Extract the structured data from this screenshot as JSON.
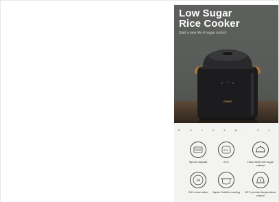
{
  "product": {
    "title_line1": "Low Sugar",
    "title_line2": "Rice Cooker",
    "subtitle": "Start a new life of sugar control",
    "brand_mark": "ONNO",
    "code": "R S 1 0 8 B - 0 4"
  },
  "features": [
    {
      "label": "Siphon asphalt",
      "icon": "siphon-icon"
    },
    {
      "label": "2.0L",
      "icon": "capacity-icon"
    },
    {
      "label": "Hand-held hole sugar cabinet",
      "icon": "lid-icon"
    },
    {
      "label": "24H reservation",
      "icon": "clock-24h-icon"
    },
    {
      "label": "Japan Goldfen coating",
      "icon": "pot-icon"
    },
    {
      "label": "NTC precise temperature control",
      "icon": "thermo-icon"
    }
  ],
  "colors": {
    "hero_bg": "#5a5c59",
    "shelf": "#4a3a2c",
    "cooker": "#1c1c1e",
    "handle": "#b87a2e",
    "panel": "#f3f3f1"
  }
}
